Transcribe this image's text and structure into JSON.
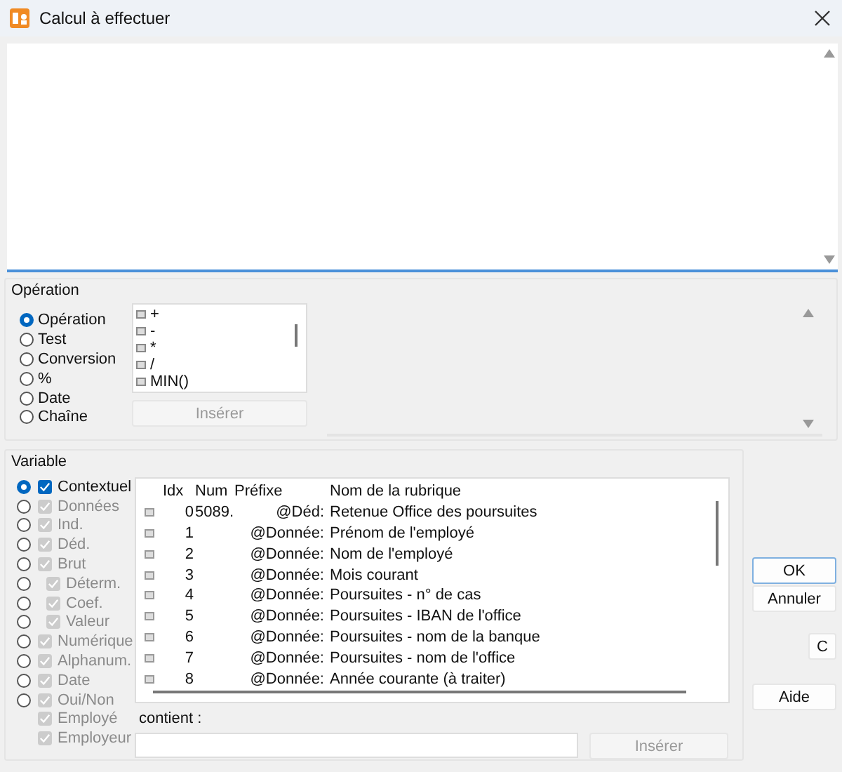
{
  "window": {
    "title": "Calcul à effectuer"
  },
  "operation": {
    "title": "Opération",
    "types": [
      {
        "label": "Opération",
        "selected": true
      },
      {
        "label": "Test",
        "selected": false
      },
      {
        "label": "Conversion",
        "selected": false
      },
      {
        "label": "%",
        "selected": false
      },
      {
        "label": "Date",
        "selected": false
      },
      {
        "label": "Chaîne",
        "selected": false
      }
    ],
    "operators": [
      "+",
      "-",
      "*",
      "/",
      "MIN()"
    ],
    "insert_button": {
      "label": "Insérer",
      "disabled": true
    }
  },
  "variable": {
    "title": "Variable",
    "filters": [
      {
        "kind": "radio",
        "label": "Contextuel",
        "selected": true,
        "checked": true,
        "disabled": false
      },
      {
        "kind": "radio",
        "label": "Données",
        "selected": false,
        "checked": true,
        "disabled": true
      },
      {
        "kind": "radio",
        "label": "Ind.",
        "selected": false,
        "checked": true,
        "disabled": true
      },
      {
        "kind": "radio",
        "label": "Déd.",
        "selected": false,
        "checked": true,
        "disabled": true
      },
      {
        "kind": "radio",
        "label": "Brut",
        "selected": false,
        "checked": true,
        "disabled": true,
        "children": [
          {
            "kind": "radio",
            "label": "Déterm.",
            "selected": false,
            "checked": true,
            "disabled": true
          },
          {
            "kind": "radio",
            "label": "Coef.",
            "selected": false,
            "checked": true,
            "disabled": true
          },
          {
            "kind": "radio",
            "label": "Valeur",
            "selected": false,
            "checked": true,
            "disabled": true
          }
        ]
      },
      {
        "kind": "radio",
        "label": "Numérique",
        "selected": false,
        "checked": true,
        "disabled": true
      },
      {
        "kind": "radio",
        "label": "Alphanum.",
        "selected": false,
        "checked": true,
        "disabled": true
      },
      {
        "kind": "radio",
        "label": "Date",
        "selected": false,
        "checked": true,
        "disabled": true
      },
      {
        "kind": "radio",
        "label": "Oui/Non",
        "selected": false,
        "checked": true,
        "disabled": true
      },
      {
        "kind": "check",
        "label": "Employé",
        "checked": true,
        "disabled": true
      },
      {
        "kind": "check",
        "label": "Employeur",
        "checked": true,
        "disabled": true
      }
    ],
    "table": {
      "columns": [
        "Idx",
        "Num",
        "Préfixe",
        "Nom de la rubrique"
      ],
      "rows": [
        {
          "idx": "0",
          "num": "5089.",
          "prefix": "@Déd:",
          "name": "Retenue Office des poursuites"
        },
        {
          "idx": "1",
          "prefix": "@Donnée:",
          "name": "Prénom de l'employé"
        },
        {
          "idx": "2",
          "prefix": "@Donnée:",
          "name": "Nom de l'employé"
        },
        {
          "idx": "3",
          "prefix": "@Donnée:",
          "name": "Mois courant"
        },
        {
          "idx": "4",
          "prefix": "@Donnée:",
          "name": "Poursuites - n° de cas"
        },
        {
          "idx": "5",
          "prefix": "@Donnée:",
          "name": "Poursuites - IBAN de l'office"
        },
        {
          "idx": "6",
          "prefix": "@Donnée:",
          "name": "Poursuites - nom de la banque"
        },
        {
          "idx": "7",
          "prefix": "@Donnée:",
          "name": "Poursuites - nom de l'office"
        },
        {
          "idx": "8",
          "prefix": "@Donnée:",
          "name": "Année courante (à traiter)"
        }
      ]
    },
    "contains_label": "contient :",
    "insert_button": {
      "label": "Insérer",
      "disabled": true
    }
  },
  "buttons": [
    {
      "kind": "default",
      "label": "OK"
    },
    {
      "kind": "normal",
      "label": "Annuler"
    },
    {
      "kind": "small",
      "label": "C"
    },
    {
      "kind": "normal",
      "label": "Aide"
    }
  ]
}
